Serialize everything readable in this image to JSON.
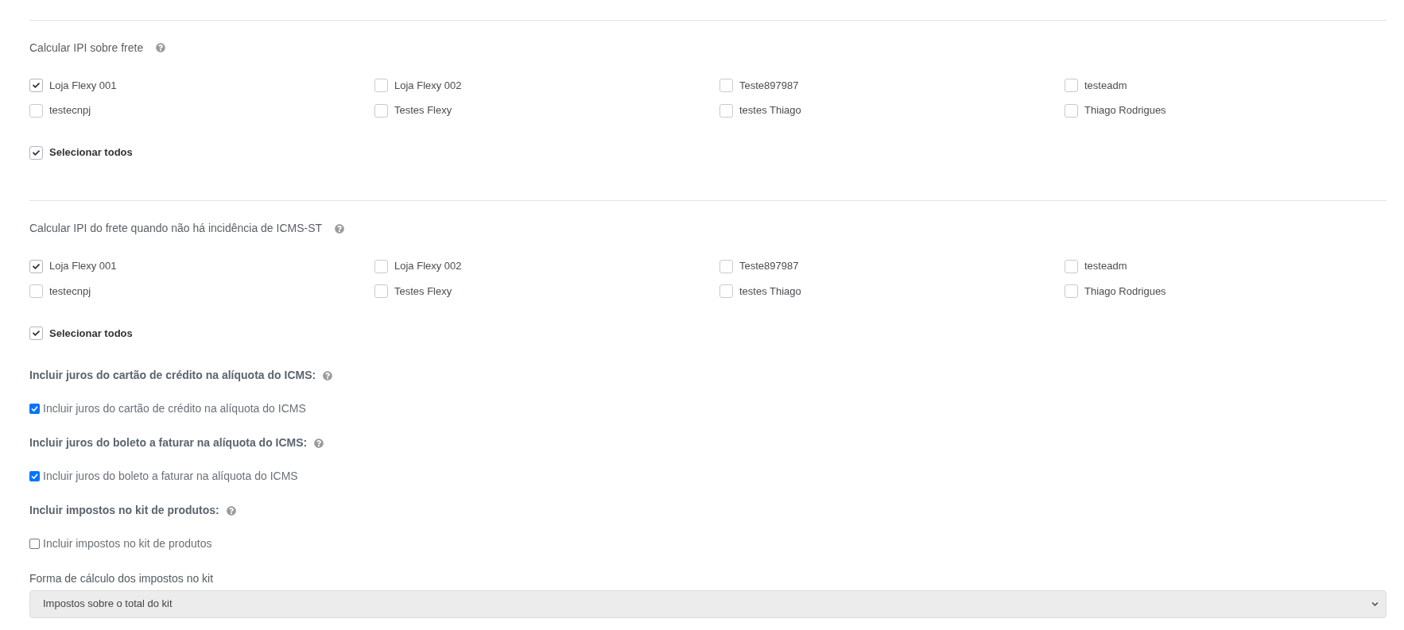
{
  "sections": [
    {
      "title": "Calcular IPI sobre frete",
      "stores": [
        {
          "label": "Loja Flexy 001",
          "checked": true
        },
        {
          "label": "Loja Flexy 002",
          "checked": false
        },
        {
          "label": "Teste897987",
          "checked": false
        },
        {
          "label": "testeadm",
          "checked": false
        },
        {
          "label": "testecnpj",
          "checked": false
        },
        {
          "label": "Testes Flexy",
          "checked": false
        },
        {
          "label": "testes Thiago",
          "checked": false
        },
        {
          "label": "Thiago Rodrigues",
          "checked": false
        }
      ],
      "select_all": {
        "label": "Selecionar todos",
        "checked": true
      }
    },
    {
      "title": "Calcular IPI do frete quando não há incidência de ICMS-ST",
      "stores": [
        {
          "label": "Loja Flexy 001",
          "checked": true
        },
        {
          "label": "Loja Flexy 002",
          "checked": false
        },
        {
          "label": "Teste897987",
          "checked": false
        },
        {
          "label": "testeadm",
          "checked": false
        },
        {
          "label": "testecnpj",
          "checked": false
        },
        {
          "label": "Testes Flexy",
          "checked": false
        },
        {
          "label": "testes Thiago",
          "checked": false
        },
        {
          "label": "Thiago Rodrigues",
          "checked": false
        }
      ],
      "select_all": {
        "label": "Selecionar todos",
        "checked": true
      }
    }
  ],
  "options": [
    {
      "heading": "Incluir juros do cartão de crédito na alíquota do ICMS:",
      "label": "Incluir juros do cartão de crédito na alíquota do ICMS",
      "checked": true
    },
    {
      "heading": "Incluir juros do boleto a faturar na alíquota do ICMS:",
      "label": "Incluir juros do boleto a faturar na alíquota do ICMS",
      "checked": true
    },
    {
      "heading": "Incluir impostos no kit de produtos:",
      "label": "Incluir impostos no kit de produtos",
      "checked": false
    }
  ],
  "kit_calculation": {
    "label": "Forma de cálculo dos impostos no kit",
    "value": "Impostos sobre o total do kit"
  }
}
